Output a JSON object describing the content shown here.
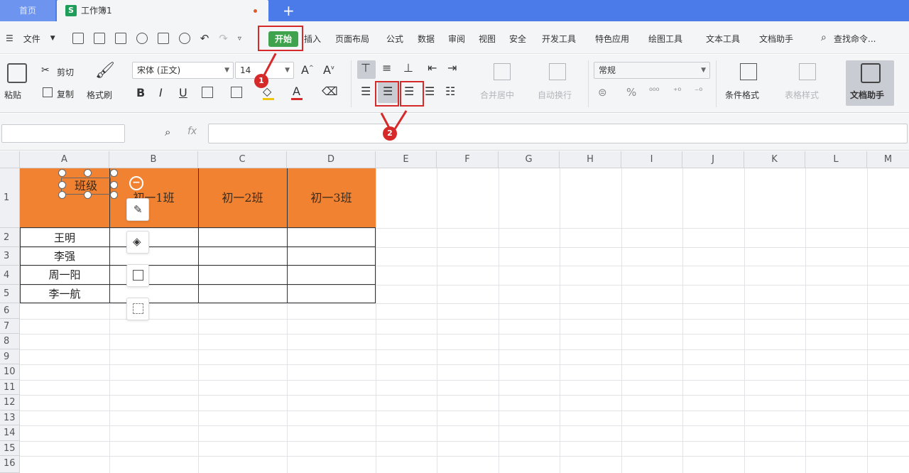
{
  "tabs": {
    "home": "首页",
    "doc": "工作簿1",
    "add": "+",
    "doc_icon": "S"
  },
  "menubar": {
    "file": "文件",
    "tabs": [
      "开始",
      "插入",
      "页面布局",
      "公式",
      "数据",
      "审阅",
      "视图",
      "安全",
      "开发工具",
      "特色应用",
      "绘图工具",
      "文本工具",
      "文档助手"
    ],
    "active_tab": "开始",
    "search": "查找命令..."
  },
  "ribbon": {
    "paste": "粘贴",
    "cut": "剪切",
    "copy": "复制",
    "format_painter": "格式刷",
    "font_name": "宋体 (正文)",
    "font_size": "14",
    "merge_center": "合并居中",
    "wrap_text": "自动换行",
    "number_format": "常规",
    "conditional_format": "条件格式",
    "table_style": "表格样式",
    "doc_assistant": "文档助手"
  },
  "annotations": {
    "one": "1",
    "two": "2",
    "color": "#d62a2a"
  },
  "sheet": {
    "columns": [
      "A",
      "B",
      "C",
      "D",
      "E",
      "F",
      "G",
      "H",
      "I",
      "J",
      "K",
      "L",
      "M"
    ],
    "rows": [
      "1",
      "2",
      "3",
      "4",
      "5",
      "6",
      "7",
      "8",
      "9",
      "10",
      "11",
      "12",
      "13",
      "14",
      "15",
      "16"
    ],
    "header_cells": [
      "班级",
      "初一1班",
      "初一2班",
      "初一3班"
    ],
    "names": [
      "王明",
      "李强",
      "周一阳",
      "李一航"
    ],
    "header_fill": "#f08232"
  }
}
